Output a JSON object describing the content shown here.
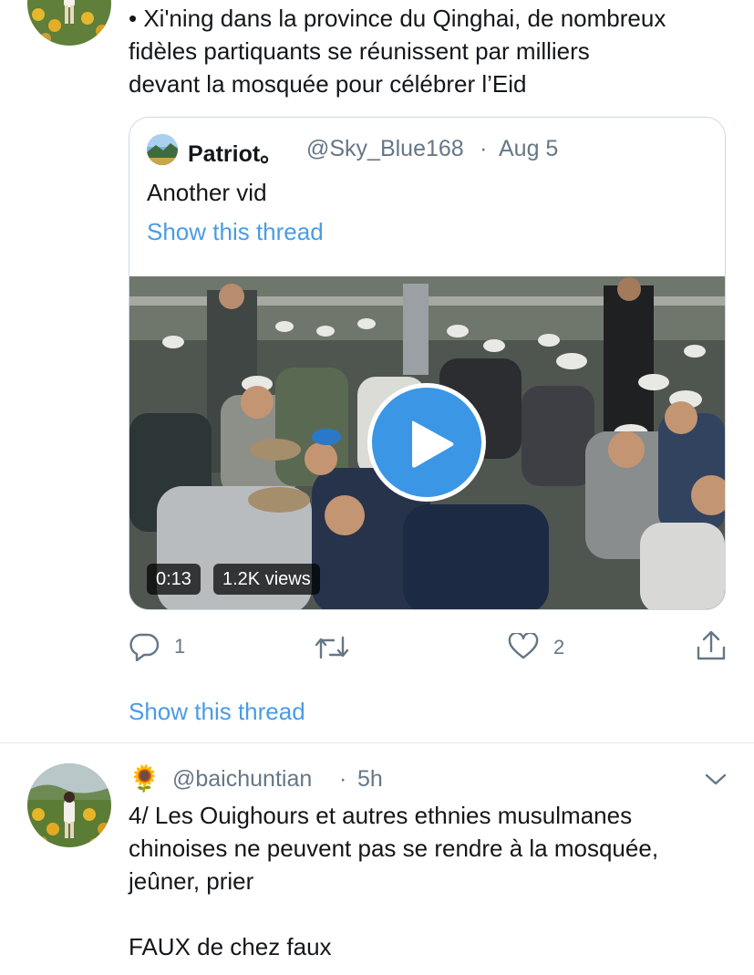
{
  "tweet1": {
    "text": "• Xi'ning dans la province du Qinghai, de nombreux\nfidèles partiquants se réunissent par milliers\ndevant la mosquée pour célébrer l’Eid",
    "avatar_icon": "user-avatar-sunflower-field",
    "quoted": {
      "name": "Patriot。",
      "handle": "@Sky_Blue168",
      "separator": "·",
      "date": "Aug 5",
      "text": "Another vid",
      "show_thread": "Show this thread",
      "video": {
        "duration": "0:13",
        "views": "1.2K views"
      }
    },
    "actions": {
      "reply_count": "1",
      "retweet_count": "",
      "like_count": "2"
    },
    "show_thread": "Show this thread"
  },
  "tweet2": {
    "emoji": "🌻",
    "handle": "@baichuntian",
    "separator": "·",
    "time": "5h",
    "text": "4/ Les Ouighours et autres ethnies musulmanes\nchinoises ne peuvent pas se rendre à la mosquée,\njeûner, prier\n\nFAUX de chez faux"
  },
  "colors": {
    "link": "#4a9be6",
    "muted": "#657786",
    "text": "#14171a",
    "border": "#cfd9de",
    "play_button": "#3b96e6"
  }
}
